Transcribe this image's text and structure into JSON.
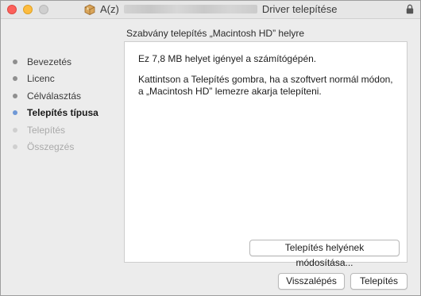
{
  "window": {
    "title_prefix": "A(z)",
    "title_main": "Driver telepítése"
  },
  "heading": "Szabvány telepítés „Macintosh HD” helyre",
  "sidebar": {
    "steps": [
      {
        "label": "Bevezetés",
        "state": "done"
      },
      {
        "label": "Licenc",
        "state": "done"
      },
      {
        "label": "Célválasztás",
        "state": "done"
      },
      {
        "label": "Telepítés típusa",
        "state": "active"
      },
      {
        "label": "Telepítés",
        "state": "pending"
      },
      {
        "label": "Összegzés",
        "state": "pending"
      }
    ]
  },
  "content": {
    "line1": "Ez 7,8 MB helyet igényel a számítógépén.",
    "line2": "Kattintson a Telepítés gombra, ha a szoftvert normál módon, a „Macintosh HD” lemezre akarja telepíteni.",
    "change_location_label": "Telepítés helyének módosítása..."
  },
  "footer": {
    "back_label": "Visszalépés",
    "install_label": "Telepítés"
  },
  "colors": {
    "close": "#fc605b",
    "minimize": "#fdbc40",
    "zoom": "#cfcfcf",
    "active_step_dot": "#6f98d6"
  },
  "icons": [
    "package-icon",
    "lock-icon"
  ]
}
